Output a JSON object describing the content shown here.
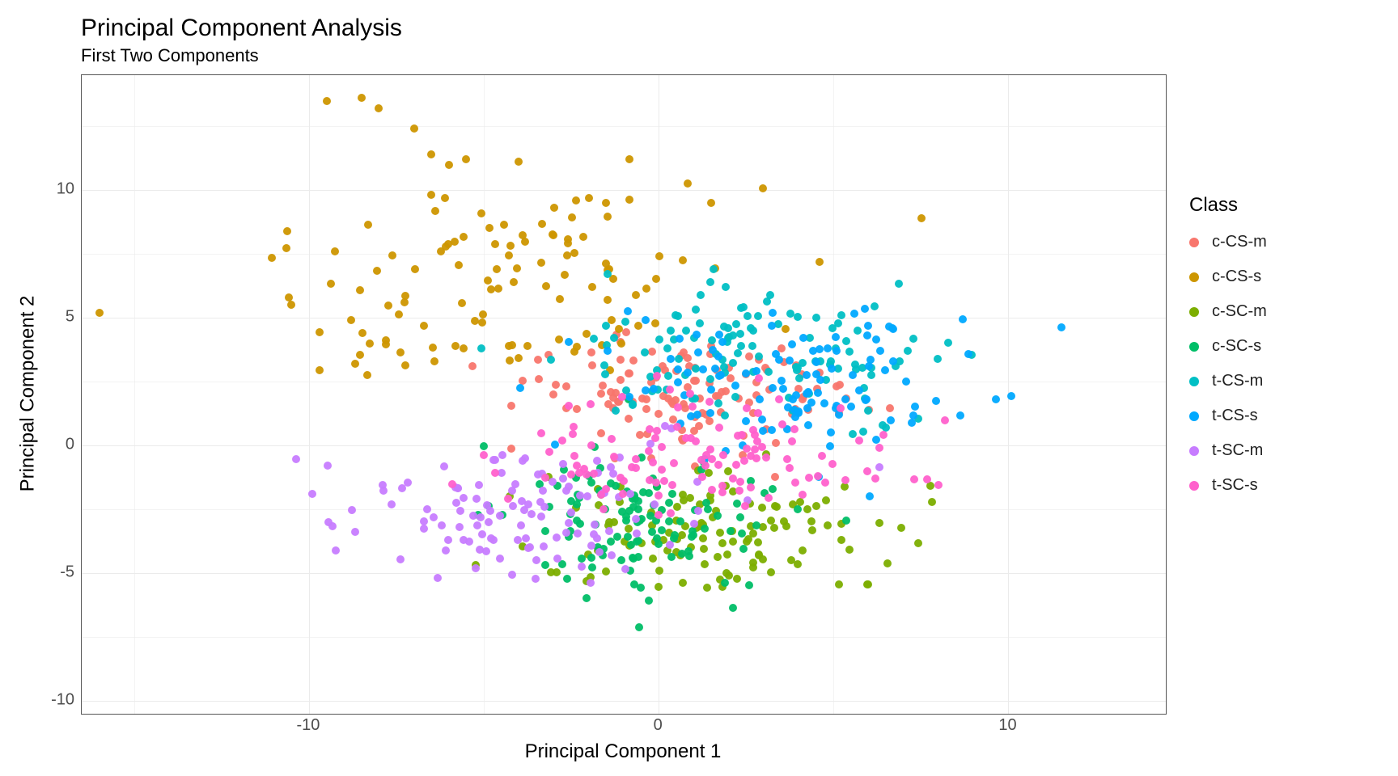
{
  "chart_data": {
    "type": "scatter",
    "title": "Principal Component Analysis",
    "subtitle": "First Two Components",
    "xlabel": "Principal Component 1",
    "ylabel": "Principal Component 2",
    "xlim": [
      -16.5,
      14.5
    ],
    "ylim": [
      -10.5,
      14.5
    ],
    "x_ticks": [
      -10,
      0,
      10
    ],
    "y_ticks": [
      -10,
      -5,
      0,
      5,
      10
    ],
    "legend_title": "Class",
    "class_colors": {
      "c-CS-m": "#F8766D",
      "c-CS-s": "#CD9600",
      "c-SC-m": "#7CAE00",
      "c-SC-s": "#00BE67",
      "t-CS-m": "#00BFC4",
      "t-CS-s": "#00A9FF",
      "t-SC-m": "#C77CFF",
      "t-SC-s": "#FF61CC"
    },
    "series": [
      {
        "name": "c-CS-m",
        "centroid": [
          0.5,
          2.0
        ],
        "spread": [
          4.5,
          2.2
        ],
        "n": 120,
        "points_note": "Approximate cloud centered slightly right-of-origin, y≈0 to 5, overlapping adjacent classes."
      },
      {
        "name": "c-CS-s",
        "centroid": [
          -4.0,
          6.5
        ],
        "spread": [
          6.0,
          4.0
        ],
        "n": 110,
        "points_note": "Distinct upper-left cluster plus tail extending to y≈13 at x≈-7 to -3; one outlier near (-16,5)."
      },
      {
        "name": "c-SC-m",
        "centroid": [
          2.0,
          -3.5
        ],
        "spread": [
          5.0,
          2.5
        ],
        "n": 120,
        "points_note": "Lower-right spread, y from -8 to 0."
      },
      {
        "name": "c-SC-s",
        "centroid": [
          -0.5,
          -3.0
        ],
        "spread": [
          3.5,
          3.0
        ],
        "n": 115,
        "points_note": "Lower-center green cluster, reaching down to y≈-9.5."
      },
      {
        "name": "t-CS-m",
        "centroid": [
          2.5,
          3.5
        ],
        "spread": [
          5.5,
          2.5
        ],
        "n": 120,
        "points_note": "Upper band across most of x-range, y≈1 to 7."
      },
      {
        "name": "t-CS-s",
        "centroid": [
          3.5,
          2.5
        ],
        "spread": [
          5.0,
          2.5
        ],
        "n": 115,
        "points_note": "Right-side upper cloud, extending to x≈12."
      },
      {
        "name": "t-SC-m",
        "centroid": [
          -4.0,
          -2.5
        ],
        "spread": [
          5.0,
          2.5
        ],
        "n": 120,
        "points_note": "Lower-left lavender cluster, x from -12 to 3."
      },
      {
        "name": "t-SC-s",
        "centroid": [
          1.0,
          -0.5
        ],
        "spread": [
          5.5,
          2.0
        ],
        "n": 115,
        "points_note": "Broad pink band near y=0 spanning most of x."
      }
    ]
  }
}
